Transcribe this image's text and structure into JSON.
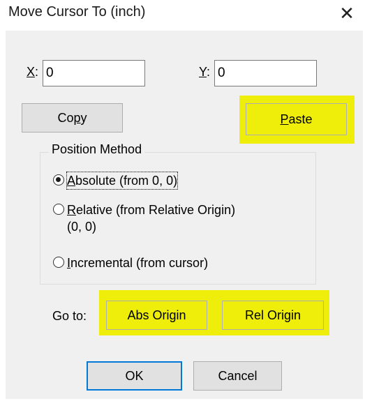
{
  "window": {
    "title": "Move Cursor To (inch)",
    "close_glyph": "✕"
  },
  "fields": {
    "x_label_key": "X",
    "x_label_rest": ":",
    "x_value": "0",
    "y_label_key": "Y",
    "y_label_rest": ":",
    "y_value": "0"
  },
  "buttons": {
    "copy_pre": "Co",
    "copy_key": "p",
    "copy_post": "y",
    "paste_key": "P",
    "paste_rest": "aste",
    "ok_label": "OK",
    "cancel_label": "Cancel",
    "abs_origin_label": "Abs Origin",
    "rel_origin_label": "Rel Origin"
  },
  "position_method": {
    "title": "Position Method",
    "options": [
      {
        "key": "A",
        "rest": "bsolute (from 0, 0)",
        "checked": true
      },
      {
        "key": "R",
        "rest": "elative (from Relative Origin)",
        "line2": "(0, 0)",
        "checked": false
      },
      {
        "key": "I",
        "rest": "ncremental (from cursor)",
        "checked": false
      }
    ]
  },
  "goto": {
    "label": "Go to:"
  },
  "colors": {
    "highlight": "#eeee0a",
    "dialog_bg": "#f0f0f0",
    "default_button_border": "#0078d7"
  },
  "icons": {
    "close": "close-icon",
    "radio": "radio-button-icon"
  }
}
